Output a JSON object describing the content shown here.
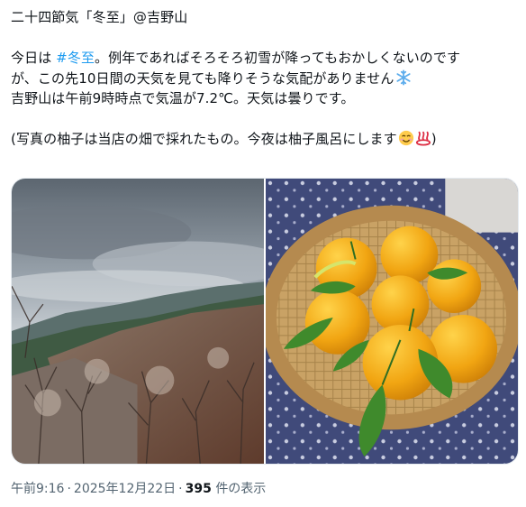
{
  "post": {
    "title": "二十四節気「冬至」@吉野山",
    "line1_prefix": "今日は ",
    "hashtag": "#冬至",
    "line1_suffix": "。例年であればそろそろ初雪が降ってもおかしくないのです",
    "line2": "が、この先10日間の天気を見ても降りそうな気配がありません",
    "line3": "吉野山は午前9時時点で気温が7.2℃。天気は曇りです。",
    "line4": "(写真の柚子は当店の畑で採れたもの。今夜は柚子風呂にします",
    "line4_end": ")",
    "emoji_snowflake": "snowflake-icon",
    "emoji_smile": "smiling-face-icon",
    "emoji_hot_springs": "hot-springs-icon"
  },
  "media": {
    "photo_left": "mountain-landscape-photo",
    "photo_right": "yuzu-basket-photo"
  },
  "meta": {
    "time": "午前9:16",
    "separator1": "·",
    "date": "2025年12月22日",
    "separator2": "·",
    "view_count": "395",
    "view_label": "件の表示"
  },
  "colors": {
    "text": "#0f1419",
    "hashtag": "#1d9bf0",
    "meta": "#536471"
  }
}
